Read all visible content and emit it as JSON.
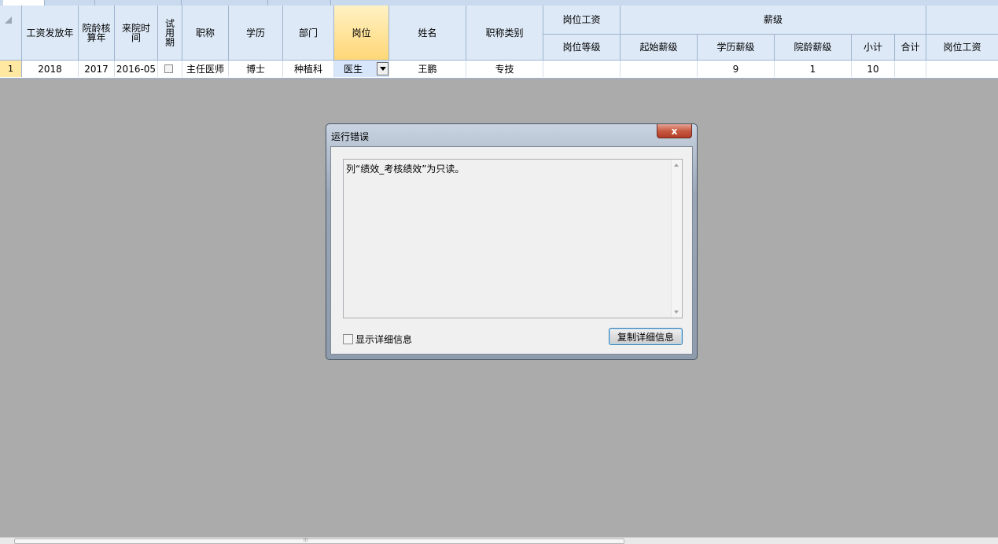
{
  "grid": {
    "columns": [
      {
        "key": "salary_year",
        "label": "工资发放年"
      },
      {
        "key": "seniority_year",
        "label": "院龄核算年"
      },
      {
        "key": "join_date",
        "label": "来院时间"
      },
      {
        "key": "probation",
        "label": "试用期"
      },
      {
        "key": "title",
        "label": "职称"
      },
      {
        "key": "education",
        "label": "学历"
      },
      {
        "key": "department",
        "label": "部门"
      },
      {
        "key": "position",
        "label": "岗位"
      },
      {
        "key": "name",
        "label": "姓名"
      },
      {
        "key": "title_category",
        "label": "职称类别"
      }
    ],
    "group_headers": {
      "post_salary_top": "岗位工资",
      "pay_grade": "薪级"
    },
    "sub_headers": {
      "post_level": "岗位等级",
      "start_grade": "起始薪级",
      "edu_grade": "学历薪级",
      "seniority_grade": "院龄薪级",
      "subtotal": "小计",
      "total": "合计",
      "post_salary": "岗位工资"
    },
    "row": {
      "number": "1",
      "salary_year": "2018",
      "seniority_year": "2017",
      "join_date": "2016-05",
      "probation_checked": false,
      "title": "主任医师",
      "education": "博士",
      "department": "种植科",
      "position": "医生",
      "name": "王鹏",
      "title_category": "专技",
      "post_level": "",
      "start_grade": "",
      "edu_grade": "9",
      "seniority_grade": "1",
      "subtotal": "10",
      "total": "",
      "post_salary": ""
    }
  },
  "dialog": {
    "title": "运行错误",
    "close_label": "x",
    "message": "列“绩效_考核绩效”为只读。",
    "show_details_label": "显示详细信息",
    "show_details_checked": false,
    "copy_button_label": "复制详细信息"
  },
  "scrollbar": {
    "grip": "|||"
  },
  "colors": {
    "header_bg": "#dde9f7",
    "highlight": "#ffe8a1",
    "desktop": "#ababab"
  }
}
